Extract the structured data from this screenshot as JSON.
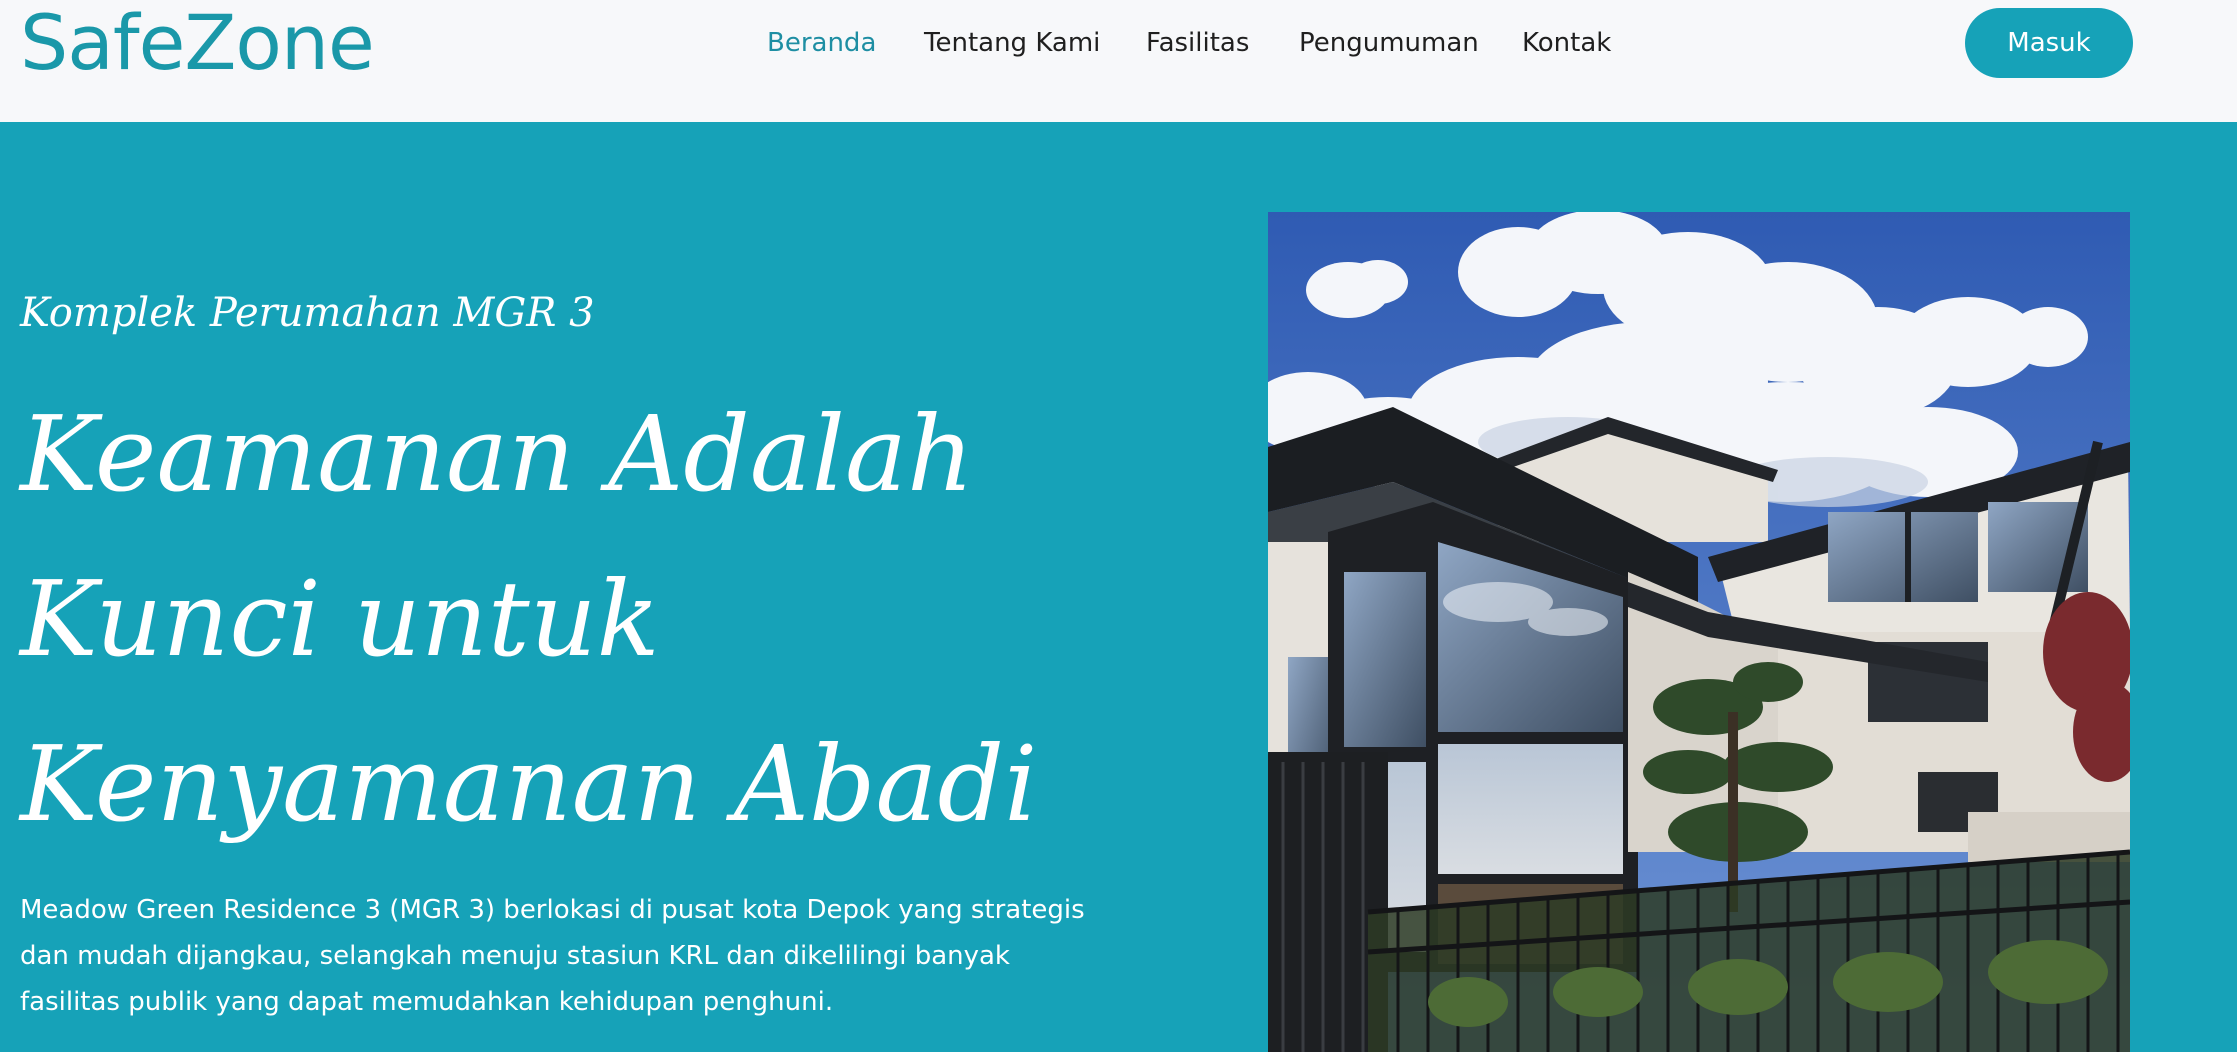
{
  "brand": {
    "name": "SafeZone"
  },
  "nav": {
    "items": [
      {
        "label": "Beranda",
        "active": true
      },
      {
        "label": "Tentang Kami",
        "active": false
      },
      {
        "label": "Fasilitas",
        "active": false
      },
      {
        "label": "Pengumuman",
        "active": false
      },
      {
        "label": "Kontak",
        "active": false
      }
    ],
    "login_label": "Masuk"
  },
  "hero": {
    "subheading": "Komplek Perumahan MGR 3",
    "headline_lines": [
      "Keamanan Adalah",
      "Kunci untuk",
      "Kenyamanan Abadi"
    ],
    "description_lines": [
      "Meadow Green Residence 3 (MGR 3) berlokasi di pusat kota Depok yang strategis",
      "dan mudah dijangkau, selangkah menuju stasiun KRL dan dikelilingi banyak",
      "fasilitas publik yang dapat memudahkan kehidupan penghuni."
    ]
  },
  "colors": {
    "primary": "#16a2b8",
    "brand_text": "#1a98a9",
    "nav_active": "#1e8ea3",
    "nav_background": "#f7f8fa",
    "hero_text": "#ffffff"
  }
}
